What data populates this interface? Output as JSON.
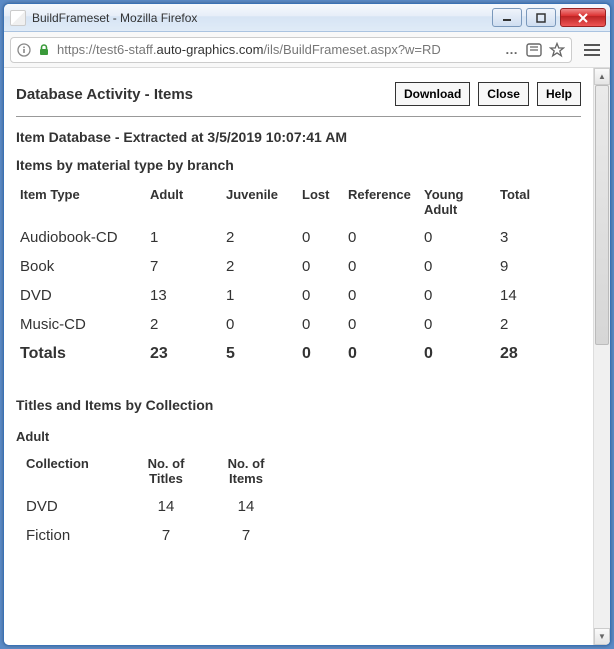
{
  "window": {
    "title": "BuildFrameset - Mozilla Firefox",
    "url_prefix": "https://test6-staff.",
    "url_bold": "auto-graphics.com",
    "url_suffix": "/ils/BuildFrameset.aspx?w=RD",
    "ellipsis": "…"
  },
  "page": {
    "title": "Database Activity - Items",
    "buttons": {
      "download": "Download",
      "close": "Close",
      "help": "Help"
    }
  },
  "extract_line": "Item Database - Extracted at 3/5/2019 10:07:41 AM",
  "section1": {
    "heading": "Items by material type by branch",
    "columns": [
      "Item Type",
      "Adult",
      "Juvenile",
      "Lost",
      "Reference",
      "Young Adult",
      "Total"
    ],
    "rows": [
      {
        "type": "Audiobook-CD",
        "vals": [
          "1",
          "2",
          "0",
          "0",
          "0",
          "3"
        ]
      },
      {
        "type": "Book",
        "vals": [
          "7",
          "2",
          "0",
          "0",
          "0",
          "9"
        ]
      },
      {
        "type": "DVD",
        "vals": [
          "13",
          "1",
          "0",
          "0",
          "0",
          "14"
        ]
      },
      {
        "type": "Music-CD",
        "vals": [
          "2",
          "0",
          "0",
          "0",
          "0",
          "2"
        ]
      }
    ],
    "totals": {
      "label": "Totals",
      "vals": [
        "23",
        "5",
        "0",
        "0",
        "0",
        "28"
      ]
    }
  },
  "section2": {
    "heading": "Titles and Items by Collection",
    "sub": "Adult",
    "columns": [
      "Collection",
      "No. of Titles",
      "No. of Items"
    ],
    "rows": [
      {
        "name": "DVD",
        "titles": "14",
        "items": "14"
      },
      {
        "name": "Fiction",
        "titles": "7",
        "items": "7"
      }
    ]
  }
}
